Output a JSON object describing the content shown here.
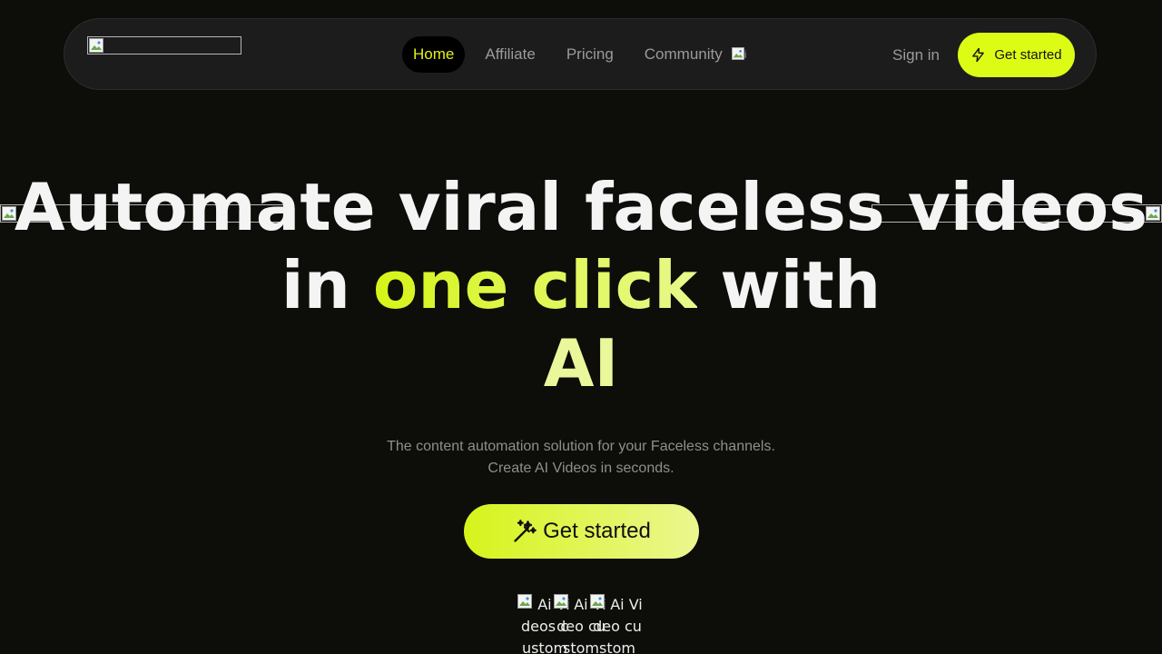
{
  "header": {
    "logo_alt": "",
    "nav": [
      {
        "label": "Home",
        "active": true
      },
      {
        "label": "Affiliate",
        "active": false
      },
      {
        "label": "Pricing",
        "active": false
      },
      {
        "label": "Community",
        "active": false
      }
    ],
    "community_img_alt": "i",
    "sign_in": "Sign in",
    "cta_label": "Get started"
  },
  "hero": {
    "headline_part1": "Automate viral faceless videos in ",
    "headline_accent": "one click",
    "headline_part2": " with ",
    "headline_ai": "AI",
    "subtitle_line1": "The content automation solution for your Faceless channels.",
    "subtitle_line2": "Create AI Videos in seconds.",
    "cta_label": "Get started"
  },
  "avatars": [
    {
      "alt": "Ai Videos custom"
    },
    {
      "alt": "Ai Video custom"
    },
    {
      "alt": "Ai Video custom"
    }
  ],
  "colors": {
    "background": "#0d0d09",
    "accent": "#dcfc16",
    "accent_light": "#eaf79b",
    "nav_bg": "#1c1c1c",
    "muted_text": "#9a9a9a"
  },
  "icons": {
    "nav_cta": "lightning-icon",
    "hero_cta": "magic-wand-icon",
    "broken_image": "broken-image-icon"
  }
}
